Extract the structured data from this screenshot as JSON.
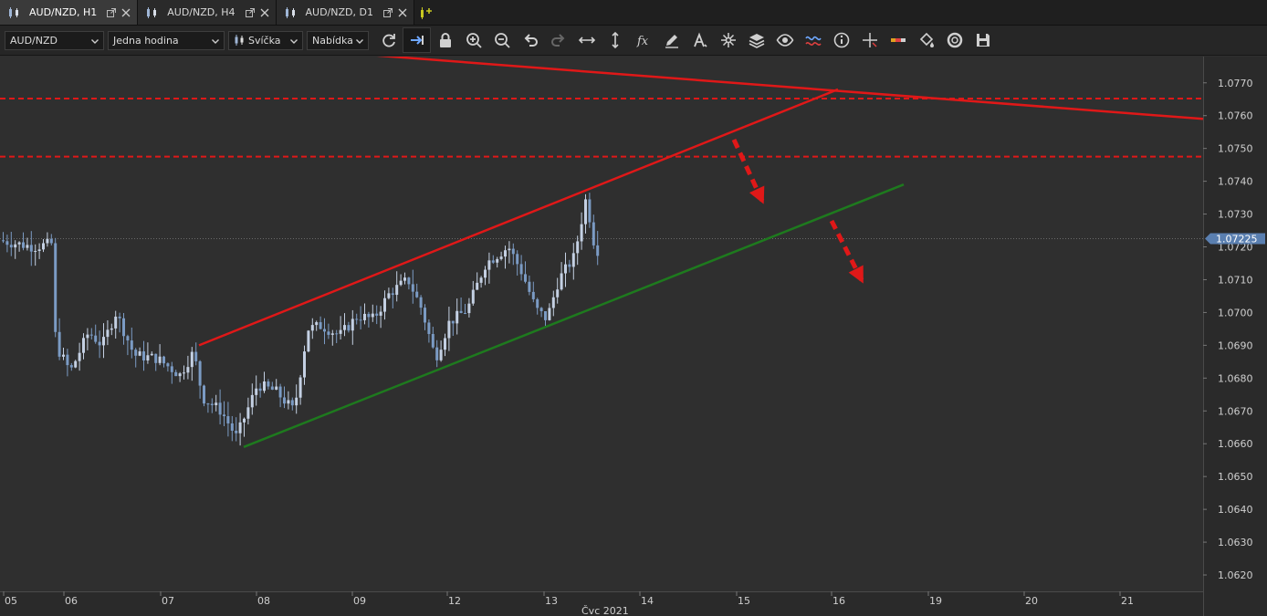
{
  "tabs": [
    {
      "label": "AUD/NZD, H1",
      "active": true
    },
    {
      "label": "AUD/NZD, H4",
      "active": false
    },
    {
      "label": "AUD/NZD, D1",
      "active": false
    }
  ],
  "toolbar": {
    "symbol": "AUD/NZD",
    "timeframe": "Jedna hodina",
    "chart_type": "Svíčka",
    "price_side": "Nabídka",
    "tools": [
      "refresh-icon",
      "autoscroll-icon",
      "lock-icon",
      "zoom-in-icon",
      "zoom-out-icon",
      "undo-icon",
      "redo-icon",
      "horizontal-resize-icon",
      "vertical-resize-icon",
      "fx-indicator-icon",
      "pencil-icon",
      "text-icon",
      "star-burst-icon",
      "layers-icon",
      "eye-icon",
      "chart-wave-icon",
      "info-icon",
      "crosshair-icon",
      "color-bar-icon",
      "fill-bucket-icon",
      "lifebuoy-icon",
      "save-icon"
    ]
  },
  "chart_data": {
    "type": "candlestick",
    "symbol": "AUD/NZD",
    "timeframe": "H1",
    "price_ticks": [
      "1.0770",
      "1.0760",
      "1.0750",
      "1.0740",
      "1.0730",
      "1.0720",
      "1.0710",
      "1.0700",
      "1.0690",
      "1.0680",
      "1.0670",
      "1.0660",
      "1.0650",
      "1.0640",
      "1.0630",
      "1.0620"
    ],
    "y_range": [
      1.0615,
      1.0778
    ],
    "current_price_label": "1.07225",
    "current_price": 1.07225,
    "x_tick_labels": [
      "05",
      "06",
      "07",
      "08",
      "09",
      "12",
      "13",
      "14",
      "15",
      "16",
      "19",
      "20",
      "21"
    ],
    "x_axis_title": "Čvc 2021",
    "horizontal_levels": [
      1.07652,
      1.07475
    ],
    "trendlines": [
      {
        "name": "resistance",
        "color": "#e01818",
        "from": [
          0,
          1.0779
        ],
        "to": [
          1,
          1.0759
        ]
      },
      {
        "name": "channel-top",
        "color": "#e01818",
        "from": [
          0,
          1.069
        ],
        "to": [
          1,
          1.0768
        ]
      },
      {
        "name": "channel-bottom",
        "color": "#1e7a1e",
        "from": [
          0,
          1.0659
        ],
        "to": [
          1,
          1.0739
        ]
      }
    ],
    "colors": {
      "up": "#c4d0e3",
      "down": "#7b9bc4",
      "level": "#e01818",
      "channel_support": "#1e7a1e",
      "price_tag": "#5a7fb0"
    }
  }
}
